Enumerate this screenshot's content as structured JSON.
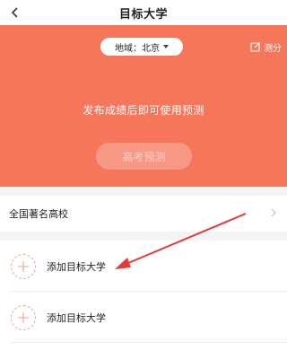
{
  "nav": {
    "title": "目标大学",
    "back_icon": "chevron-left-icon"
  },
  "hero": {
    "background_color": "#f5765b",
    "region_label": "地域：北京",
    "region_caret_icon": "caret-down-icon",
    "score_label": "测分",
    "score_icon": "edit-icon",
    "message": "发布成绩后即可使用预测",
    "predict_button": "高考预测",
    "predict_enabled": false
  },
  "famous": {
    "label": "全国著名高校",
    "chevron_icon": "chevron-right-icon"
  },
  "targets": [
    {
      "label": "添加目标大学",
      "icon": "plus-icon"
    },
    {
      "label": "添加目标大学",
      "icon": "plus-icon"
    }
  ],
  "annotation": {
    "arrow_color": "#e53935"
  }
}
